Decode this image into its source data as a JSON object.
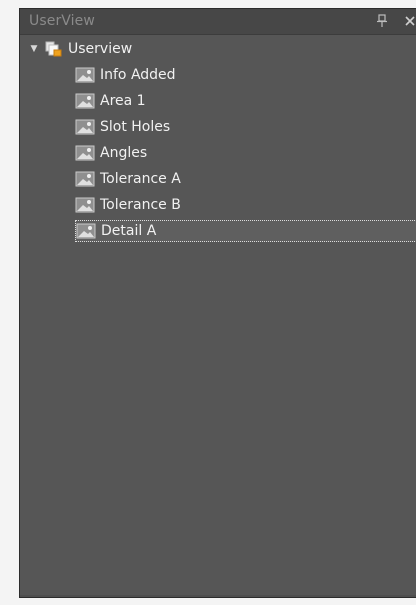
{
  "panel": {
    "title": "UserView",
    "pin_icon": "pin-icon",
    "close_icon": "close-icon"
  },
  "tree": {
    "root": {
      "label": "Userview",
      "expanded": true,
      "icon": "userview-folder-icon"
    },
    "items": [
      {
        "label": "Info Added",
        "icon": "view-icon"
      },
      {
        "label": "Area 1",
        "icon": "view-icon"
      },
      {
        "label": "Slot Holes",
        "icon": "view-icon"
      },
      {
        "label": "Angles",
        "icon": "view-icon"
      },
      {
        "label": "Tolerance A",
        "icon": "view-icon"
      },
      {
        "label": "Tolerance B",
        "icon": "view-icon"
      },
      {
        "label": "Detail A",
        "icon": "view-icon",
        "selected": true
      }
    ]
  },
  "colors": {
    "panel_bg": "#565656",
    "text": "#f1f1f1",
    "title_text": "#8a8a8a"
  }
}
